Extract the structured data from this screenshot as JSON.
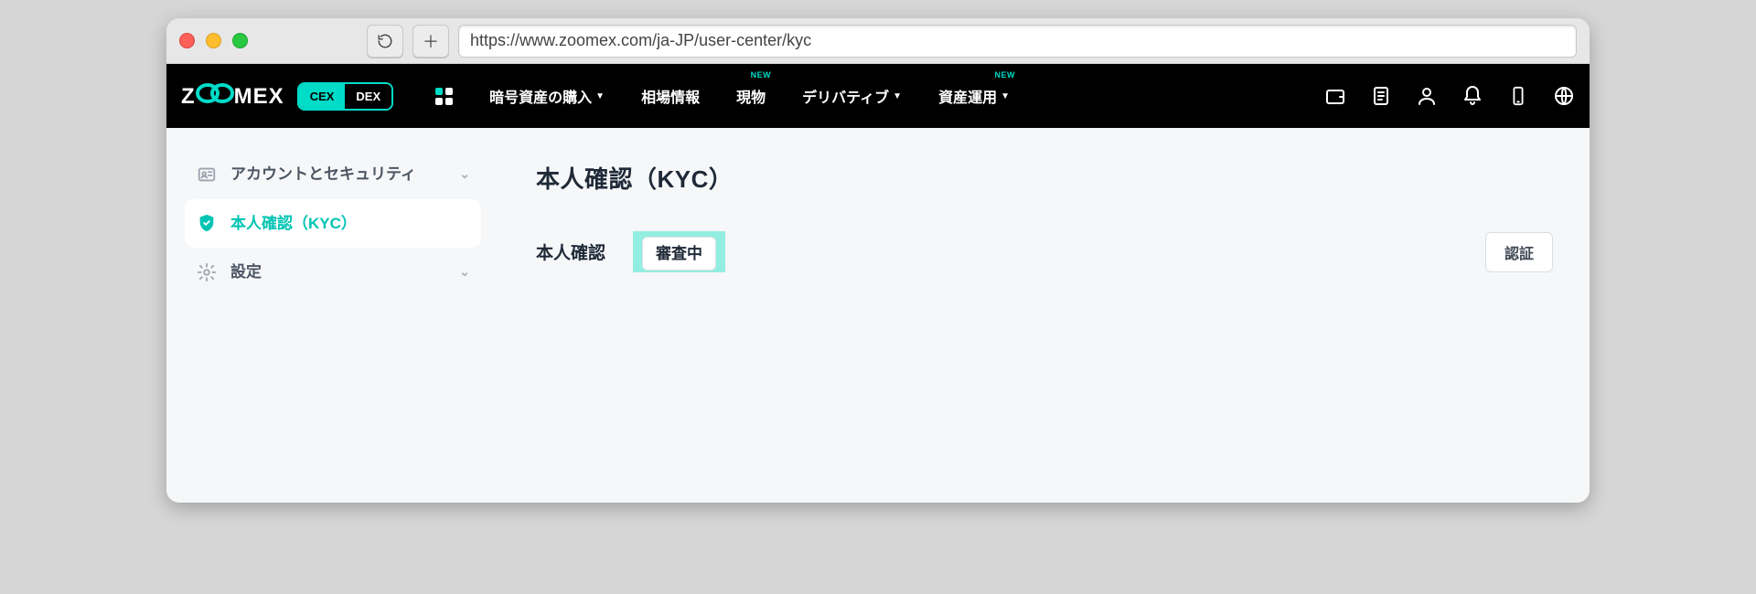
{
  "browser": {
    "url": "https://www.zoomex.com/ja-JP/user-center/kyc"
  },
  "topnav": {
    "brand": "ZOOMEX",
    "toggle": {
      "cex": "CEX",
      "dex": "DEX"
    },
    "items": [
      {
        "label": "暗号資産の購入",
        "has_caret": true
      },
      {
        "label": "相場情報"
      },
      {
        "label": "現物",
        "badge": "NEW"
      },
      {
        "label": "デリバティブ",
        "has_caret": true
      },
      {
        "label": "資産運用",
        "has_caret": true,
        "badge": "NEW"
      }
    ]
  },
  "sidebar": {
    "items": [
      {
        "label": "アカウントとセキュリティ",
        "expandable": true
      },
      {
        "label": "本人確認（KYC）",
        "active": true
      },
      {
        "label": "設定",
        "expandable": true
      }
    ]
  },
  "main": {
    "title": "本人確認（KYC）",
    "row_label": "本人確認",
    "status": "審査中",
    "verify_button": "認証"
  },
  "colors": {
    "accent": "#00dcc8",
    "highlight": "#92eee0"
  }
}
